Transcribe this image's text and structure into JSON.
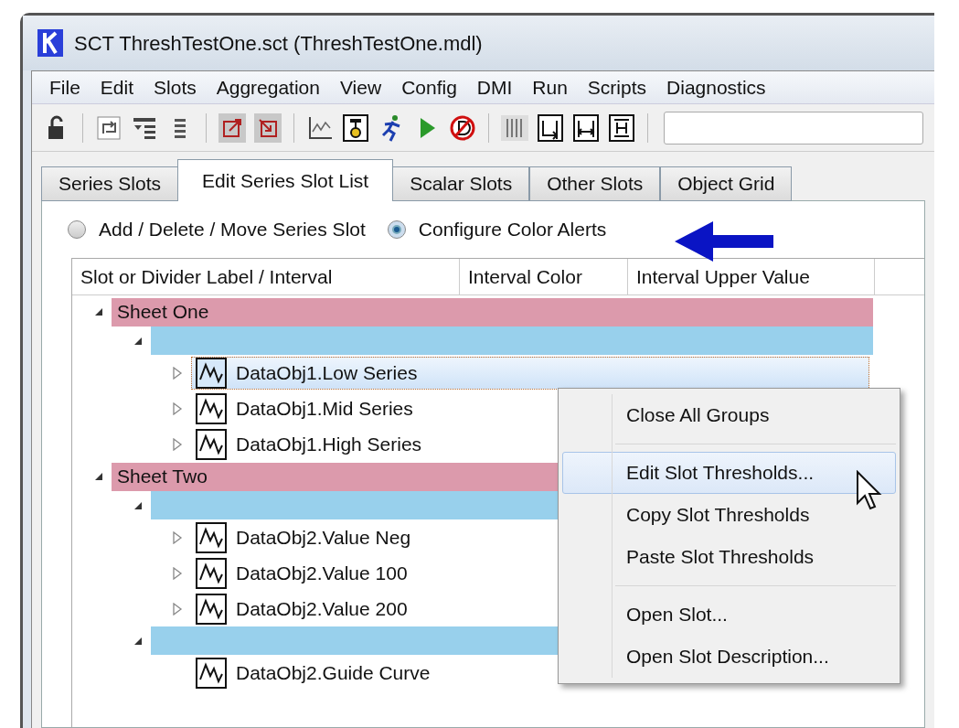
{
  "window": {
    "title": "SCT ThreshTestOne.sct (ThreshTestOne.mdl)"
  },
  "menu": [
    "File",
    "Edit",
    "Slots",
    "Aggregation",
    "View",
    "Config",
    "DMI",
    "Run",
    "Scripts",
    "Diagnostics"
  ],
  "tabs": [
    {
      "label": "Series Slots",
      "selected": false
    },
    {
      "label": "Edit Series Slot List",
      "selected": true
    },
    {
      "label": "Scalar Slots",
      "selected": false
    },
    {
      "label": "Other Slots",
      "selected": false
    },
    {
      "label": "Object Grid",
      "selected": false
    }
  ],
  "modes": [
    {
      "label": "Add / Delete / Move Series Slot",
      "selected": false
    },
    {
      "label": "Configure Color Alerts",
      "selected": true
    }
  ],
  "table": {
    "columns": [
      "Slot or Divider Label / Interval",
      "Interval Color",
      "Interval Upper Value"
    ],
    "tree": [
      {
        "kind": "sheet",
        "label": "Sheet One",
        "expandable": true,
        "expanded": true,
        "children": [
          {
            "kind": "divider",
            "expandable": true,
            "expanded": true,
            "children": [
              {
                "kind": "slot",
                "label": "DataObj1.Low Series",
                "expandable": true,
                "expanded": false,
                "selected": true
              },
              {
                "kind": "slot",
                "label": "DataObj1.Mid Series",
                "expandable": true,
                "expanded": false,
                "selected": false
              },
              {
                "kind": "slot",
                "label": "DataObj1.High Series",
                "expandable": true,
                "expanded": false,
                "selected": false
              }
            ]
          }
        ]
      },
      {
        "kind": "sheet",
        "label": "Sheet Two",
        "expandable": true,
        "expanded": true,
        "children": [
          {
            "kind": "divider",
            "expandable": true,
            "expanded": true,
            "children": [
              {
                "kind": "slot",
                "label": "DataObj2.Value Neg",
                "expandable": true,
                "expanded": false,
                "selected": false
              },
              {
                "kind": "slot",
                "label": "DataObj2.Value 100",
                "expandable": true,
                "expanded": false,
                "selected": false
              },
              {
                "kind": "slot",
                "label": "DataObj2.Value 200",
                "expandable": true,
                "expanded": false,
                "selected": false
              }
            ]
          },
          {
            "kind": "divider",
            "expandable": true,
            "expanded": true,
            "children": [
              {
                "kind": "slot",
                "label": "DataObj2.Guide Curve",
                "expandable": false,
                "selected": false
              }
            ]
          }
        ]
      }
    ]
  },
  "context_menu": [
    {
      "kind": "item",
      "label": "Close All Groups",
      "highlighted": false
    },
    {
      "kind": "separator"
    },
    {
      "kind": "item",
      "label": "Edit Slot Thresholds...",
      "highlighted": true
    },
    {
      "kind": "item",
      "label": "Copy Slot Thresholds",
      "highlighted": false
    },
    {
      "kind": "item",
      "label": "Paste Slot Thresholds",
      "highlighted": false
    },
    {
      "kind": "separator"
    },
    {
      "kind": "item",
      "label": "Open Slot...",
      "highlighted": false
    },
    {
      "kind": "item",
      "label": "Open Slot Description...",
      "highlighted": false
    }
  ]
}
